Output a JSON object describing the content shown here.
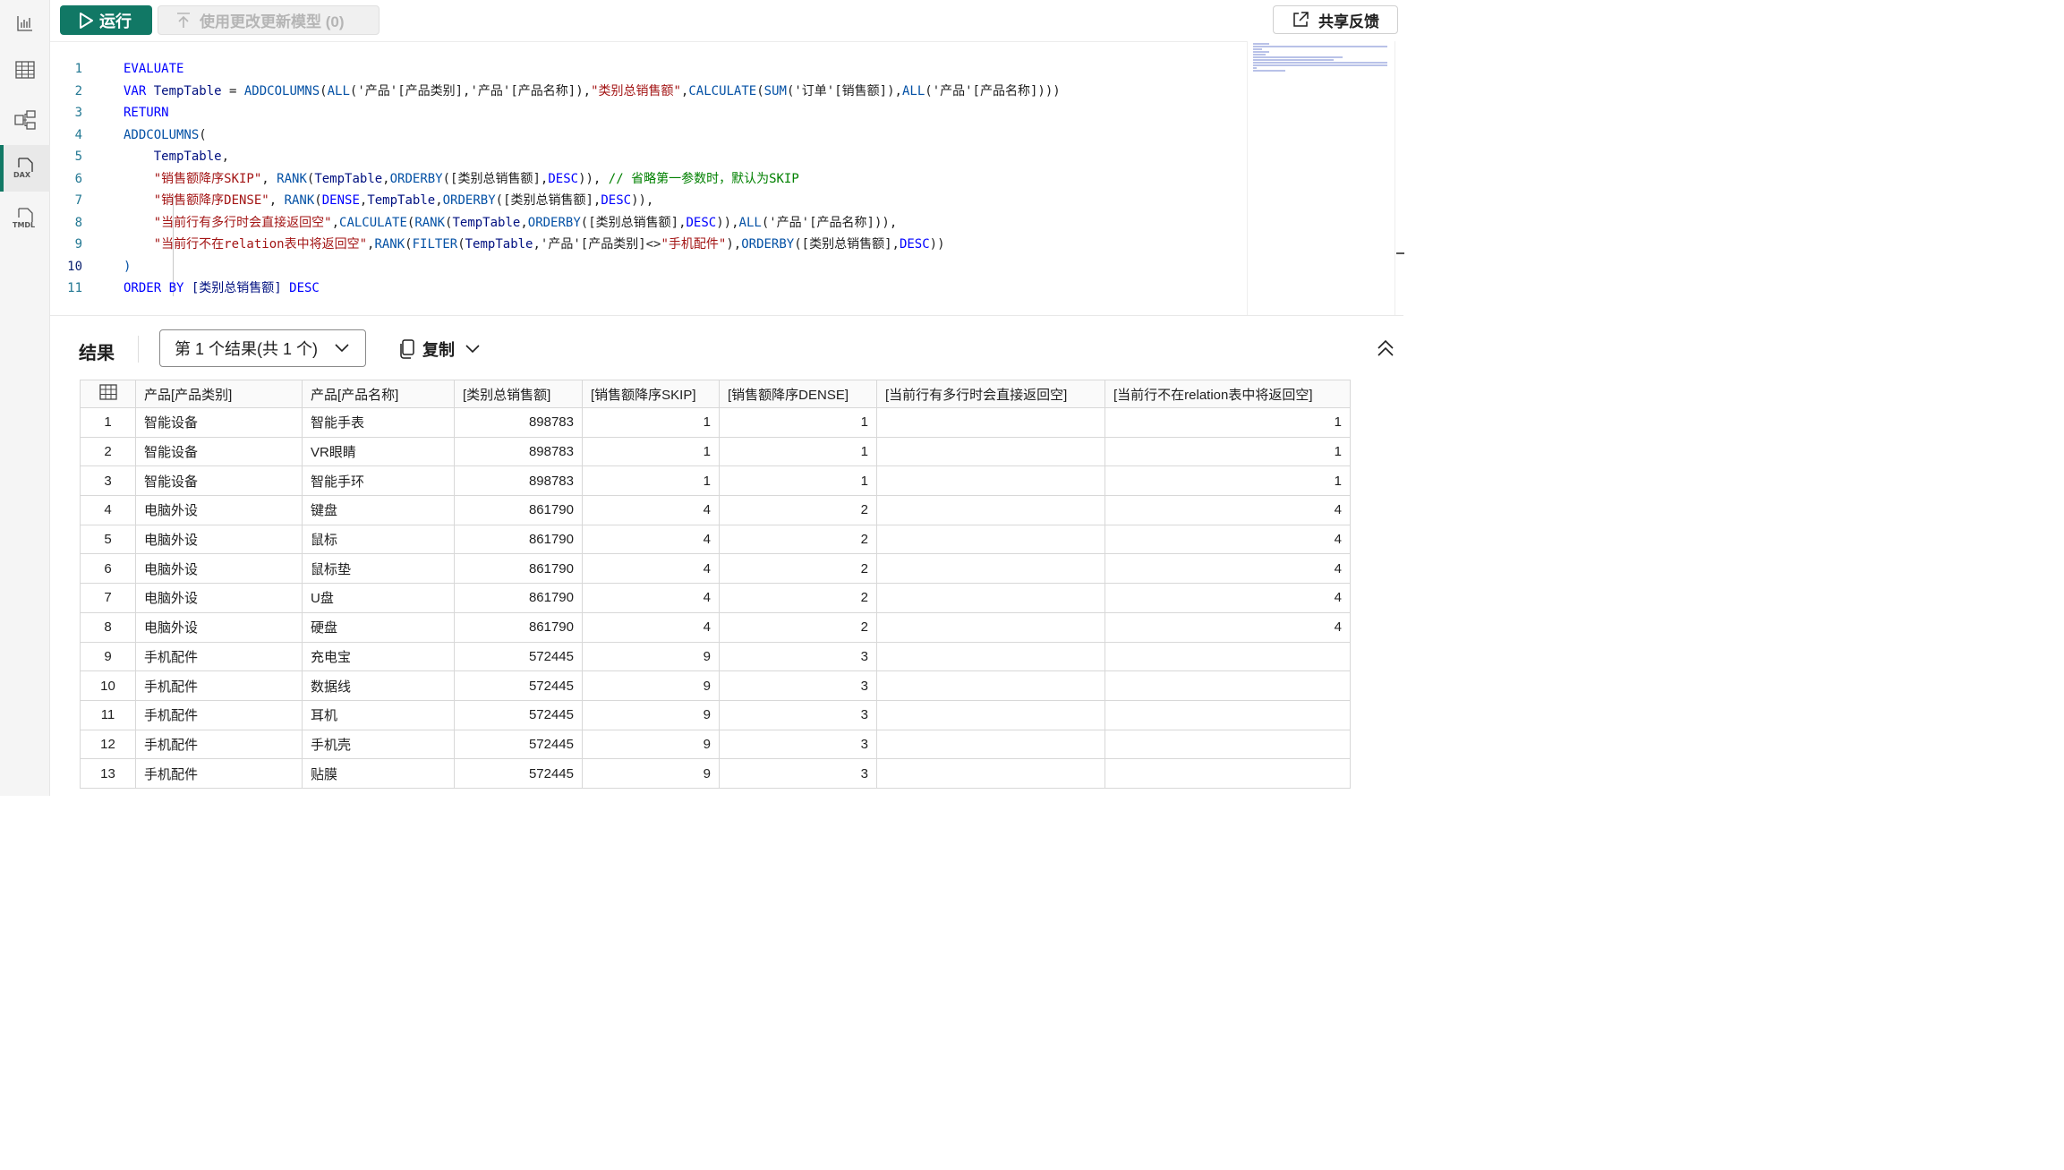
{
  "toolbar": {
    "run_label": "运行",
    "update_label": "使用更改更新模型 (0)",
    "share_label": "共享反馈"
  },
  "rail": {
    "dax_label": "DAX",
    "tmdl_label": "TMDL"
  },
  "editor": {
    "line_numbers": [
      "1",
      "2",
      "3",
      "4",
      "5",
      "6",
      "7",
      "8",
      "9",
      "10",
      "11"
    ],
    "lines": [
      [
        {
          "t": "EVALUATE",
          "c": "k"
        }
      ],
      [
        {
          "t": "VAR ",
          "c": "k"
        },
        {
          "t": "TempTable",
          "c": "v"
        },
        {
          "t": " = ",
          "c": "p"
        },
        {
          "t": "ADDCOLUMNS",
          "c": "f"
        },
        {
          "t": "(",
          "c": "p"
        },
        {
          "t": "ALL",
          "c": "f"
        },
        {
          "t": "('产品'[产品类别],'产品'[产品名称]),",
          "c": "p"
        },
        {
          "t": "\"类别总销售额\"",
          "c": "s"
        },
        {
          "t": ",",
          "c": "p"
        },
        {
          "t": "CALCULATE",
          "c": "f"
        },
        {
          "t": "(",
          "c": "p"
        },
        {
          "t": "SUM",
          "c": "f"
        },
        {
          "t": "('订单'[销售额]),",
          "c": "p"
        },
        {
          "t": "ALL",
          "c": "f"
        },
        {
          "t": "('产品'[产品名称])))",
          "c": "p"
        }
      ],
      [
        {
          "t": "RETURN",
          "c": "k"
        }
      ],
      [
        {
          "t": "ADDCOLUMNS",
          "c": "f"
        },
        {
          "t": "(",
          "c": "p"
        }
      ],
      [
        {
          "t": "    TempTable",
          "c": "v"
        },
        {
          "t": ",",
          "c": "p"
        }
      ],
      [
        {
          "t": "    \"销售额降序SKIP\"",
          "c": "s"
        },
        {
          "t": ", ",
          "c": "p"
        },
        {
          "t": "RANK",
          "c": "f"
        },
        {
          "t": "(",
          "c": "p"
        },
        {
          "t": "TempTable",
          "c": "v"
        },
        {
          "t": ",",
          "c": "p"
        },
        {
          "t": "ORDERBY",
          "c": "f"
        },
        {
          "t": "([类别总销售额],",
          "c": "p"
        },
        {
          "t": "DESC",
          "c": "k"
        },
        {
          "t": ")), ",
          "c": "p"
        },
        {
          "t": "// 省略第一参数时，默认为SKIP",
          "c": "c"
        }
      ],
      [
        {
          "t": "    \"销售额降序DENSE\"",
          "c": "s"
        },
        {
          "t": ", ",
          "c": "p"
        },
        {
          "t": "RANK",
          "c": "f"
        },
        {
          "t": "(",
          "c": "p"
        },
        {
          "t": "DENSE",
          "c": "k"
        },
        {
          "t": ",",
          "c": "p"
        },
        {
          "t": "TempTable",
          "c": "v"
        },
        {
          "t": ",",
          "c": "p"
        },
        {
          "t": "ORDERBY",
          "c": "f"
        },
        {
          "t": "([类别总销售额],",
          "c": "p"
        },
        {
          "t": "DESC",
          "c": "k"
        },
        {
          "t": ")),",
          "c": "p"
        }
      ],
      [
        {
          "t": "    \"当前行有多行时会直接返回空\"",
          "c": "s"
        },
        {
          "t": ",",
          "c": "p"
        },
        {
          "t": "CALCULATE",
          "c": "f"
        },
        {
          "t": "(",
          "c": "p"
        },
        {
          "t": "RANK",
          "c": "f"
        },
        {
          "t": "(",
          "c": "p"
        },
        {
          "t": "TempTable",
          "c": "v"
        },
        {
          "t": ",",
          "c": "p"
        },
        {
          "t": "ORDERBY",
          "c": "f"
        },
        {
          "t": "([类别总销售额],",
          "c": "p"
        },
        {
          "t": "DESC",
          "c": "k"
        },
        {
          "t": ")),",
          "c": "p"
        },
        {
          "t": "ALL",
          "c": "f"
        },
        {
          "t": "('产品'[产品名称])),",
          "c": "p"
        }
      ],
      [
        {
          "t": "    \"当前行不在relation表中将返回空\"",
          "c": "s"
        },
        {
          "t": ",",
          "c": "p"
        },
        {
          "t": "RANK",
          "c": "f"
        },
        {
          "t": "(",
          "c": "p"
        },
        {
          "t": "FILTER",
          "c": "f"
        },
        {
          "t": "(",
          "c": "p"
        },
        {
          "t": "TempTable",
          "c": "v"
        },
        {
          "t": ",'产品'[产品类别]<>",
          "c": "p"
        },
        {
          "t": "\"手机配件\"",
          "c": "s"
        },
        {
          "t": "),",
          "c": "p"
        },
        {
          "t": "ORDERBY",
          "c": "f"
        },
        {
          "t": "([类别总销售额],",
          "c": "p"
        },
        {
          "t": "DESC",
          "c": "k"
        },
        {
          "t": "))",
          "c": "p"
        }
      ],
      [
        {
          "t": ")",
          "c": "f"
        }
      ],
      [
        {
          "t": "ORDER BY ",
          "c": "k"
        },
        {
          "t": "[类别总销售额]",
          "c": "v"
        },
        {
          "t": " DESC",
          "c": "k"
        }
      ]
    ]
  },
  "results": {
    "title": "结果",
    "selector": "第 1 个结果(共 1 个)",
    "copy_label": "复制",
    "columns": [
      "产品[产品类别]",
      "产品[产品名称]",
      "[类别总销售额]",
      "[销售额降序SKIP]",
      "[销售额降序DENSE]",
      "[当前行有多行时会直接返回空]",
      "[当前行不在relation表中将返回空]"
    ],
    "rows": [
      [
        "1",
        "智能设备",
        "智能手表",
        "898783",
        "1",
        "1",
        "",
        "1"
      ],
      [
        "2",
        "智能设备",
        "VR眼睛",
        "898783",
        "1",
        "1",
        "",
        "1"
      ],
      [
        "3",
        "智能设备",
        "智能手环",
        "898783",
        "1",
        "1",
        "",
        "1"
      ],
      [
        "4",
        "电脑外设",
        "键盘",
        "861790",
        "4",
        "2",
        "",
        "4"
      ],
      [
        "5",
        "电脑外设",
        "鼠标",
        "861790",
        "4",
        "2",
        "",
        "4"
      ],
      [
        "6",
        "电脑外设",
        "鼠标垫",
        "861790",
        "4",
        "2",
        "",
        "4"
      ],
      [
        "7",
        "电脑外设",
        "U盘",
        "861790",
        "4",
        "2",
        "",
        "4"
      ],
      [
        "8",
        "电脑外设",
        "硬盘",
        "861790",
        "4",
        "2",
        "",
        "4"
      ],
      [
        "9",
        "手机配件",
        "充电宝",
        "572445",
        "9",
        "3",
        "",
        ""
      ],
      [
        "10",
        "手机配件",
        "数据线",
        "572445",
        "9",
        "3",
        "",
        ""
      ],
      [
        "11",
        "手机配件",
        "耳机",
        "572445",
        "9",
        "3",
        "",
        ""
      ],
      [
        "12",
        "手机配件",
        "手机壳",
        "572445",
        "9",
        "3",
        "",
        ""
      ],
      [
        "13",
        "手机配件",
        "贴膜",
        "572445",
        "9",
        "3",
        "",
        ""
      ]
    ]
  }
}
